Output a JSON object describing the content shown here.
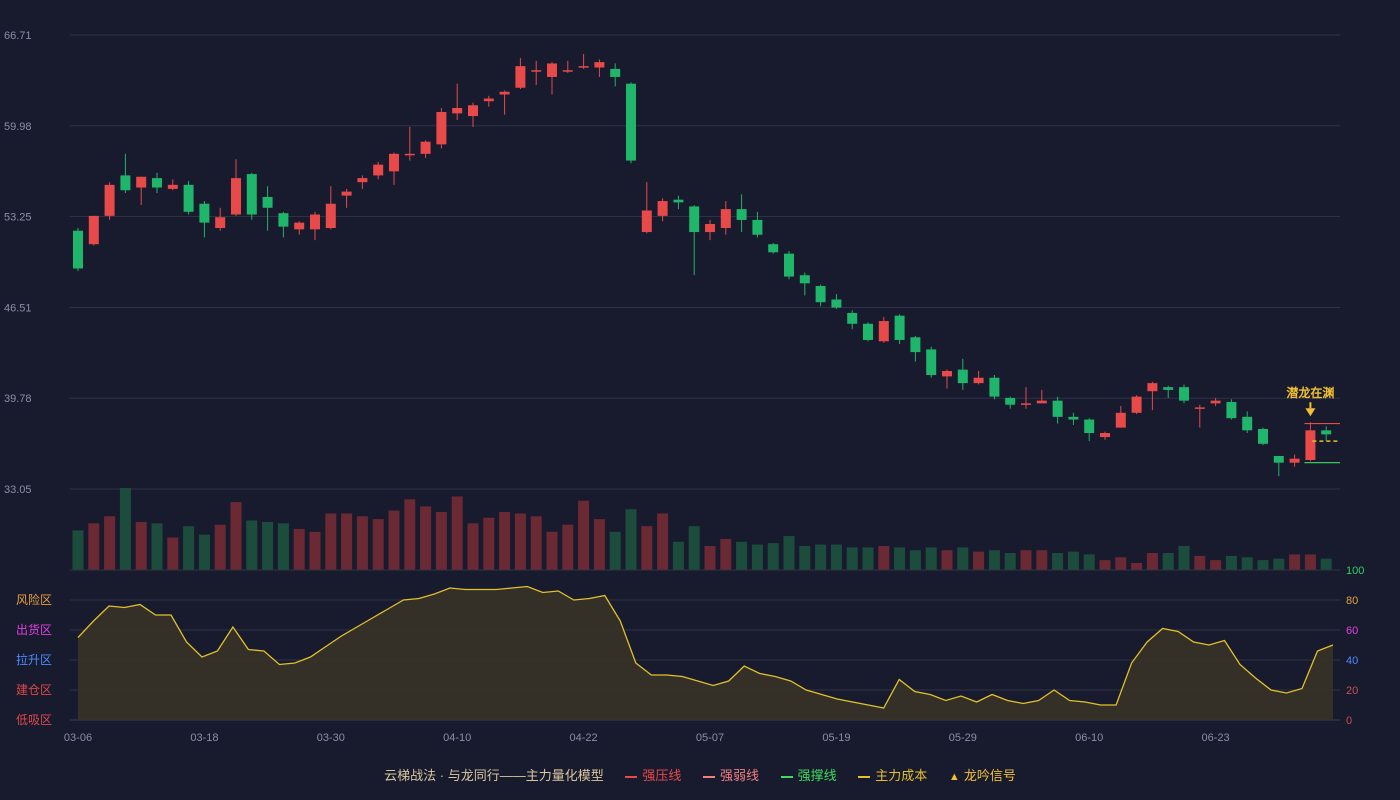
{
  "colors": {
    "background": "#181a2e",
    "up": "#e84a4a",
    "down": "#1fb56a",
    "vol_up": "#6b2a33",
    "vol_down": "#1c4d3c",
    "grid": "#2f3247",
    "indicator_line": "#e2c12a",
    "indicator_fill": "#3a3426",
    "signal": "#f0c030",
    "support": "#3ddc5a"
  },
  "chart_data": {
    "type": "candlestick",
    "y_ticks": [
      "66.71",
      "59.98",
      "53.25",
      "46.51",
      "39.78",
      "33.05"
    ],
    "ylim": [
      33.05,
      66.71
    ],
    "x_ticks": [
      "03-06",
      "03-18",
      "03-30",
      "04-10",
      "04-22",
      "05-07",
      "05-19",
      "05-29",
      "06-10",
      "06-23"
    ],
    "candles": [
      [
        52.2,
        49.4,
        52.4,
        49.2
      ],
      [
        51.2,
        53.3,
        53.3,
        51.1
      ],
      [
        53.3,
        55.6,
        55.8,
        53.0
      ],
      [
        56.3,
        55.2,
        57.9,
        55.0
      ],
      [
        55.4,
        56.2,
        56.2,
        54.1
      ],
      [
        56.1,
        55.4,
        56.5,
        55.0
      ],
      [
        55.3,
        55.6,
        56.0,
        55.2
      ],
      [
        55.6,
        53.6,
        55.9,
        53.4
      ],
      [
        54.2,
        52.8,
        54.4,
        51.7
      ],
      [
        52.4,
        53.2,
        53.9,
        52.2
      ],
      [
        53.4,
        56.1,
        57.5,
        53.3
      ],
      [
        56.4,
        53.4,
        56.5,
        53.0
      ],
      [
        54.7,
        53.9,
        55.5,
        52.2
      ],
      [
        53.5,
        52.5,
        53.6,
        51.7
      ],
      [
        52.3,
        52.8,
        52.9,
        51.9
      ],
      [
        52.3,
        53.4,
        53.6,
        51.5
      ],
      [
        52.4,
        54.2,
        55.5,
        52.3
      ],
      [
        54.8,
        55.1,
        55.3,
        53.9
      ],
      [
        55.8,
        56.1,
        56.3,
        55.3
      ],
      [
        56.3,
        57.1,
        57.3,
        56.0
      ],
      [
        56.6,
        57.9,
        58.0,
        55.6
      ],
      [
        57.9,
        57.9,
        59.9,
        57.4
      ],
      [
        57.9,
        58.8,
        58.9,
        57.6
      ],
      [
        58.6,
        61.0,
        61.3,
        58.3
      ],
      [
        60.9,
        61.3,
        63.1,
        60.4
      ],
      [
        60.7,
        61.5,
        61.7,
        59.9
      ],
      [
        61.8,
        62.0,
        62.2,
        61.4
      ],
      [
        62.3,
        62.5,
        62.6,
        60.8
      ],
      [
        62.8,
        64.4,
        65.0,
        62.7
      ],
      [
        64.1,
        64.1,
        64.8,
        63.0
      ],
      [
        63.6,
        64.6,
        64.7,
        62.3
      ],
      [
        64.1,
        64.1,
        64.8,
        63.9
      ],
      [
        64.4,
        64.4,
        65.3,
        64.2
      ],
      [
        64.3,
        64.7,
        64.9,
        63.6
      ],
      [
        64.2,
        63.6,
        64.6,
        62.9
      ],
      [
        63.1,
        57.4,
        63.2,
        57.2
      ],
      [
        52.1,
        53.7,
        55.8,
        52.0
      ],
      [
        53.3,
        54.4,
        54.6,
        52.9
      ],
      [
        54.5,
        54.3,
        54.8,
        53.8
      ],
      [
        54.0,
        52.1,
        54.1,
        48.9
      ],
      [
        52.1,
        52.7,
        53.0,
        51.5
      ],
      [
        52.4,
        53.8,
        54.4,
        51.9
      ],
      [
        53.8,
        53.0,
        54.9,
        52.1
      ],
      [
        53.0,
        51.9,
        53.6,
        51.7
      ],
      [
        51.2,
        50.6,
        51.3,
        50.5
      ],
      [
        50.5,
        48.8,
        50.7,
        48.6
      ],
      [
        48.9,
        48.3,
        49.1,
        47.4
      ],
      [
        48.1,
        46.9,
        48.2,
        46.6
      ],
      [
        47.1,
        46.5,
        47.5,
        46.4
      ],
      [
        46.1,
        45.3,
        46.3,
        44.9
      ],
      [
        45.3,
        44.1,
        45.4,
        44.0
      ],
      [
        44.0,
        45.5,
        45.8,
        43.9
      ],
      [
        45.9,
        44.1,
        46.0,
        43.8
      ],
      [
        44.3,
        43.2,
        44.4,
        42.5
      ],
      [
        43.4,
        41.5,
        43.6,
        41.3
      ],
      [
        41.4,
        41.8,
        41.9,
        40.5
      ],
      [
        41.9,
        40.9,
        42.7,
        40.4
      ],
      [
        40.9,
        41.3,
        41.8,
        40.8
      ],
      [
        41.3,
        39.9,
        41.5,
        39.7
      ],
      [
        39.8,
        39.3,
        39.9,
        39.0
      ],
      [
        39.3,
        39.4,
        40.6,
        39.0
      ],
      [
        39.4,
        39.6,
        40.4,
        39.4
      ],
      [
        39.6,
        38.4,
        39.9,
        37.9
      ],
      [
        38.4,
        38.2,
        38.7,
        37.8
      ],
      [
        38.2,
        37.2,
        38.3,
        36.6
      ],
      [
        36.9,
        37.2,
        37.3,
        36.7
      ],
      [
        37.6,
        38.7,
        39.2,
        37.6
      ],
      [
        38.7,
        39.9,
        40.0,
        38.6
      ],
      [
        40.3,
        40.9,
        41.0,
        38.9
      ],
      [
        40.6,
        40.4,
        40.7,
        39.8
      ],
      [
        40.6,
        39.6,
        40.8,
        39.4
      ],
      [
        39.1,
        39.1,
        39.3,
        37.6
      ],
      [
        39.4,
        39.6,
        39.8,
        39.2
      ],
      [
        39.5,
        38.3,
        39.7,
        38.2
      ],
      [
        38.4,
        37.4,
        38.8,
        37.2
      ],
      [
        37.5,
        36.4,
        37.6,
        36.3
      ],
      [
        35.5,
        35.0,
        35.5,
        34.0
      ],
      [
        35.0,
        35.3,
        35.6,
        34.7
      ],
      [
        35.2,
        37.4,
        38.0,
        35.1
      ],
      [
        37.4,
        37.1,
        37.7,
        36.6
      ]
    ],
    "volume": [
      28,
      33,
      38,
      58,
      34,
      33,
      23,
      31,
      25,
      32,
      48,
      35,
      34,
      33,
      29,
      27,
      40,
      40,
      38,
      36,
      42,
      50,
      45,
      41,
      52,
      33,
      37,
      41,
      40,
      38,
      27,
      32,
      49,
      36,
      27,
      43,
      31,
      40,
      20,
      31,
      17,
      22,
      20,
      18,
      19,
      24,
      17,
      18,
      18,
      16,
      16,
      17,
      16,
      14,
      16,
      14,
      16,
      13,
      14,
      12,
      14,
      14,
      12,
      13,
      11,
      7,
      9,
      5,
      12,
      12,
      17,
      10,
      7,
      10,
      9,
      7,
      8,
      11,
      11,
      8
    ],
    "indicator": {
      "y_ticks": [
        "0",
        "20",
        "40",
        "60",
        "80",
        "100"
      ],
      "ylim": [
        0,
        100
      ],
      "zones": [
        "风险区",
        "出货区",
        "拉升区",
        "建仓区",
        "低吸区"
      ],
      "values": [
        55,
        66,
        76,
        75,
        77,
        70,
        70,
        52,
        42,
        46,
        62,
        47,
        46,
        37,
        38,
        42,
        49,
        56,
        62,
        68,
        74,
        80,
        81,
        84,
        88,
        87,
        87,
        87,
        88,
        89,
        85,
        86,
        80,
        81,
        83,
        66,
        38,
        30,
        30,
        29,
        26,
        23,
        26,
        36,
        31,
        29,
        26,
        20,
        17,
        14,
        12,
        10,
        8,
        27,
        19,
        17,
        13,
        16,
        12,
        17,
        13,
        11,
        13,
        20,
        13,
        12,
        10,
        10,
        38,
        52,
        61,
        59,
        52,
        50,
        53,
        37,
        28,
        20,
        18,
        21,
        46,
        50
      ]
    },
    "signal": {
      "label": "潜龙在渊",
      "candle": 78
    },
    "levels": {
      "resistance": 37.9,
      "cost": 36.6,
      "support": 35.0
    }
  },
  "legend": {
    "title": "云梯战法 · 与龙同行——主力量化模型",
    "items": [
      {
        "label": "强压线",
        "color": "#e84a4a"
      },
      {
        "label": "强弱线",
        "color": "#f08080"
      },
      {
        "label": "强撑线",
        "color": "#3ddc5a"
      },
      {
        "label": "主力成本",
        "color": "#e2c12a"
      },
      {
        "label": "龙吟信号",
        "color": "#f0c030"
      }
    ]
  }
}
